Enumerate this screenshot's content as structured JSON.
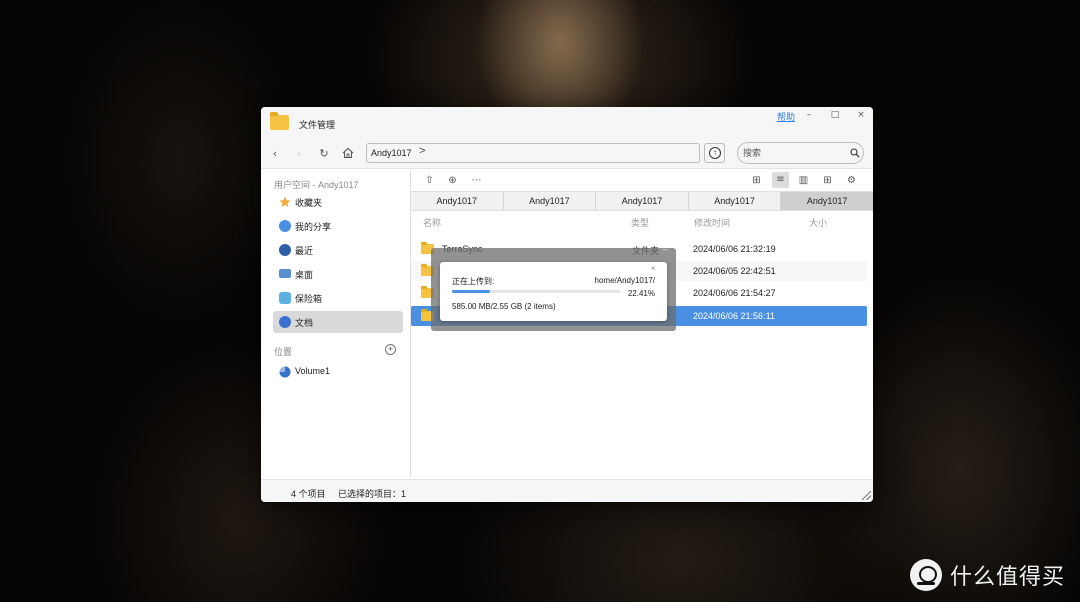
{
  "window": {
    "title": "文件管理",
    "help_label": "帮助",
    "minimize_glyph": "–",
    "maximize_glyph": "□",
    "close_glyph": "×"
  },
  "toolbar": {
    "back_icon": "chevron-left-icon",
    "forward_icon": "chevron-right-icon",
    "refresh_icon": "refresh-icon",
    "home_icon": "home-icon",
    "path": "Andy1017",
    "path_chevron": ">",
    "upload_icon": "upload-arrow-icon",
    "search_placeholder": "搜索"
  },
  "sidebar": {
    "user_space_label": "用户空间 - Andy1017",
    "items": [
      {
        "label": "收藏夹",
        "icon": "star-icon",
        "color": "#f2a93b"
      },
      {
        "label": "我的分享",
        "icon": "share-icon",
        "color": "#4a90e2"
      },
      {
        "label": "最近",
        "icon": "clock-icon",
        "color": "#2e5fa8"
      },
      {
        "label": "桌面",
        "icon": "desktop-icon",
        "color": "#5a8fd0"
      },
      {
        "label": "保险箱",
        "icon": "safe-icon",
        "color": "#5ab0e0"
      },
      {
        "label": "文档",
        "icon": "document-icon",
        "color": "#3b6fd0"
      }
    ],
    "active_index": 5,
    "location_label": "位置",
    "volume_label": "Volume1",
    "volume_icon": "pie-disk-icon"
  },
  "main_toolbar": {
    "upload_icon": "upload-icon",
    "new_icon": "plus-circle-icon",
    "more_icon": "more-icon",
    "grid_view_icon": "grid-view-icon",
    "list_view_icon": "list-view-icon",
    "column_view_icon": "column-view-icon",
    "new_tab_icon": "new-tab-icon",
    "settings_icon": "gear-icon"
  },
  "tabs": [
    "Andy1017",
    "Andy1017",
    "Andy1017",
    "Andy1017",
    "Andy1017"
  ],
  "active_tab": 4,
  "columns": {
    "name": "名称",
    "type": "类型",
    "modified": "修改时间",
    "size": "大小"
  },
  "files": [
    {
      "name": "TerraSync",
      "type": "文件夹",
      "modified": "2024/06/06 21:32:19"
    },
    {
      "name": "",
      "type": "",
      "modified": "2024/06/05 22:42:51"
    },
    {
      "name": "",
      "type": "",
      "modified": "2024/06/06 21:54:27"
    },
    {
      "name": "",
      "type": "",
      "modified": "2024/06/06 21:56:11"
    }
  ],
  "status": {
    "item_count": "4 个项目",
    "selected": "已选择的项目：1"
  },
  "upload_dialog": {
    "label": "正在上传到:",
    "destination": "home/Andy1017/",
    "progress": 0.2241,
    "percent": "22.41%",
    "size_text": "585.00 MB/2.55 GB  (2 items)",
    "close_glyph": "×",
    "minimize_glyph": "–"
  },
  "watermark": {
    "text": "什么值得买",
    "logo_icon": "smzdm-logo-icon"
  }
}
